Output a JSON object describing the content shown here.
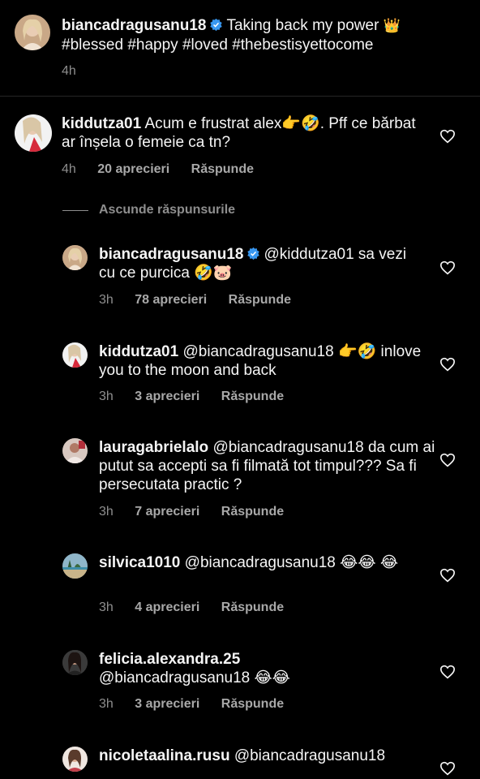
{
  "caption": {
    "username": "biancadragusanu18",
    "text": "Taking back my power",
    "emoji": "👑",
    "hashtags": "#blessed #happy #loved #thebestisyettocome",
    "time": "4h",
    "verified_icon": "verified-badge-icon"
  },
  "top_comment": {
    "username": "kiddutza01",
    "text": "Acum e frustrat alex👉🤣. Pff ce bărbat ar înșela o femeie ca tn?",
    "time": "4h",
    "likes": "20 aprecieri",
    "reply": "Răspunde"
  },
  "hide_replies_label": "Ascunde răspunsurile",
  "replies": [
    {
      "username": "biancadragusanu18",
      "verified": true,
      "text": "@kiddutza01 sa vezi cu ce purcica 🤣🐷",
      "time": "3h",
      "likes": "78 aprecieri",
      "reply": "Răspunde"
    },
    {
      "username": "kiddutza01",
      "text": "@biancadragusanu18 👉🤣 inlove you to the moon and back",
      "time": "3h",
      "likes": "3 aprecieri",
      "reply": "Răspunde"
    },
    {
      "username": "lauragabrielalo",
      "text": "@biancadragusanu18 da cum ai putut sa accepti sa fi filmată tot timpul??? Sa fi persecutata practic ?",
      "time": "3h",
      "likes": "7 aprecieri",
      "reply": "Răspunde"
    },
    {
      "username": "silvica1010",
      "text": "@biancadragusanu18 😂😂 😂",
      "time": "3h",
      "likes": "4 aprecieri",
      "reply": "Răspunde"
    },
    {
      "username": "felicia.alexandra.25",
      "text": "@biancadragusanu18 😂😂",
      "time": "3h",
      "likes": "3 aprecieri",
      "reply": "Răspunde"
    },
    {
      "username": "nicoletaalina.rusu",
      "text": "@biancadragusanu18",
      "time": "",
      "likes": "",
      "reply": ""
    }
  ],
  "colors": {
    "background": "#000000",
    "text": "#f5f5f5",
    "muted": "#8e8e8e",
    "verified": "#3897f0"
  }
}
